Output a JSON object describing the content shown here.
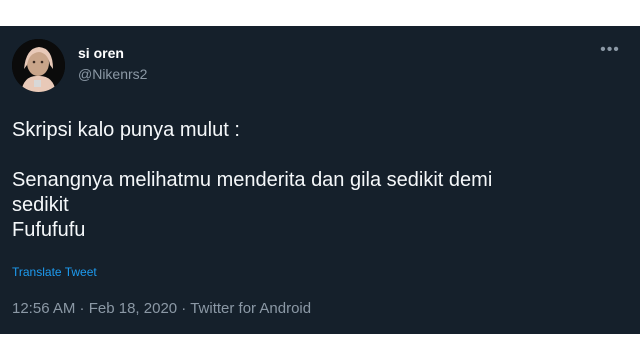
{
  "user": {
    "display_name": "si oren",
    "handle": "@Nikenrs2",
    "avatar_icon": "profile-photo"
  },
  "tweet": {
    "line1": "Skripsi kalo punya mulut :",
    "line2": "Senangnya melihatmu menderita dan gila sedikit demi",
    "line3": "sedikit",
    "line4": "Fufufufu"
  },
  "translate_label": "Translate Tweet",
  "meta": {
    "time": "12:56 AM",
    "separator": " · ",
    "date": "Feb 18, 2020",
    "source": "Twitter for Android"
  },
  "more_icon": "more-options-icon",
  "colors": {
    "background": "#15202b",
    "text": "#ffffff",
    "secondary": "#8b98a5",
    "link": "#1d9bf0"
  }
}
